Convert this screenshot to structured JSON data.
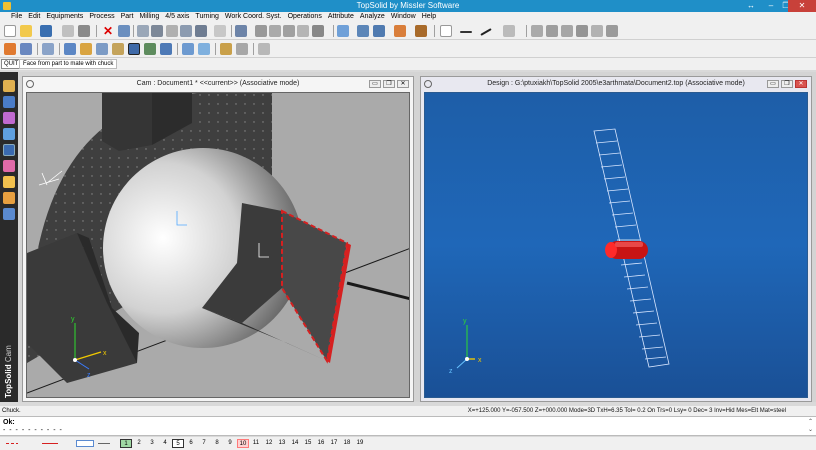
{
  "app": {
    "title": "TopSolid by Missler Software",
    "controls": [
      "↔",
      "–",
      "❐",
      "✕"
    ]
  },
  "menu": [
    "File",
    "Edit",
    "Equipments",
    "Process",
    "Part",
    "Milling",
    "4/5 axis",
    "Turning",
    "Work Coord. Syst.",
    "Operations",
    "Attribute",
    "Analyze",
    "Window",
    "Help"
  ],
  "command": {
    "quit_label": "QUIT",
    "prompt": "Face from part to mate with chuck"
  },
  "cam_window": {
    "title": "Cam : Document1 * <<current>> (Associative mode)",
    "buttons": [
      "▭",
      "❐",
      "✕"
    ]
  },
  "design_window": {
    "title": "Design : G:\\ptuxiakh\\TopSolid 2005\\e3arthmata\\Document2.top (Associative mode)",
    "buttons": [
      "▭",
      "❐",
      "✕"
    ]
  },
  "sidebar": {
    "brand": "TopSolid",
    "module": "Cam"
  },
  "status": {
    "hint": "Chuck.",
    "readout": "X=+125.000  Y=-057.500  Z=+000.000  Mode=3D  TxH=6.35  Tol= 0.2  On  Trs=0  Lsy= 0  Dec= 3  Inv=Hid  Mes=Elt  Mat=steel"
  },
  "messages": {
    "ok": "Ok:",
    "dashes": "- - - - - - - - - -"
  },
  "axes": {
    "x": "x",
    "y": "y",
    "z": "z"
  },
  "layers": [
    "1",
    "2",
    "3",
    "4",
    "5",
    "6",
    "7",
    "8",
    "9",
    "10",
    "11",
    "12",
    "13",
    "14",
    "15",
    "16",
    "17",
    "18",
    "19"
  ],
  "colors": {
    "titlebar": "#1f8fc8",
    "cam_bg": "#a9a9a9",
    "design_bg": "#1f67b8",
    "accent_red": "#d62020"
  }
}
